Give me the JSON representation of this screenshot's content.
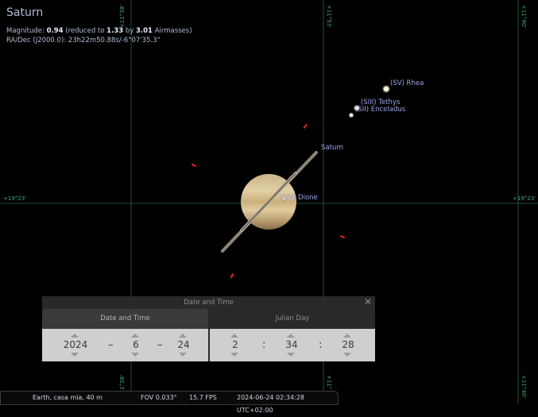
{
  "object": {
    "name": "Saturn",
    "magnitude_label": "Magnitude:",
    "magnitude": "0.94",
    "reduced_text": "(reduced to",
    "reduced_value": "1.33",
    "by_text": "by",
    "airmass_value": "3.01",
    "airmass_text": "Airmasses)",
    "radec": "RA/Dec (J2000.0): 23h22m50.88s/-6°07'35.3\""
  },
  "grid_labels": {
    "left_dec": "+19°23'",
    "right_dec": "+19°23'",
    "top_ra_1": "+11°38'",
    "top_ra_2": "+11°53'",
    "top_ra_3": "+11°40'",
    "bottom_ra_1": "+11°38'",
    "bottom_ra_2": "+11°",
    "bottom_ra_3": "+11°40'"
  },
  "labels": {
    "saturn": "Saturn",
    "rhea": "(SV) Rhea",
    "tethys": "(SIII) Tethys",
    "enceladus": "(SII) Enceladus",
    "dione": "(SIV) Dione"
  },
  "datetime": {
    "title": "Date and Time",
    "tab_date": "Date and Time",
    "tab_julian": "Julian Day",
    "year": "2024",
    "month": "6",
    "day": "24",
    "hour": "2",
    "minute": "34",
    "second": "28",
    "dash": "–",
    "colon": ":"
  },
  "status": {
    "location": "Earth, casa mia, 40 m",
    "fov": "FOV 0.033°",
    "fps": "15.7 FPS",
    "time": "2024-06-24 02:34:28 UTC+02:00"
  },
  "colors": {
    "grid": "#1f6b47",
    "label": "#9aa6e6",
    "marker": "#e02020"
  }
}
